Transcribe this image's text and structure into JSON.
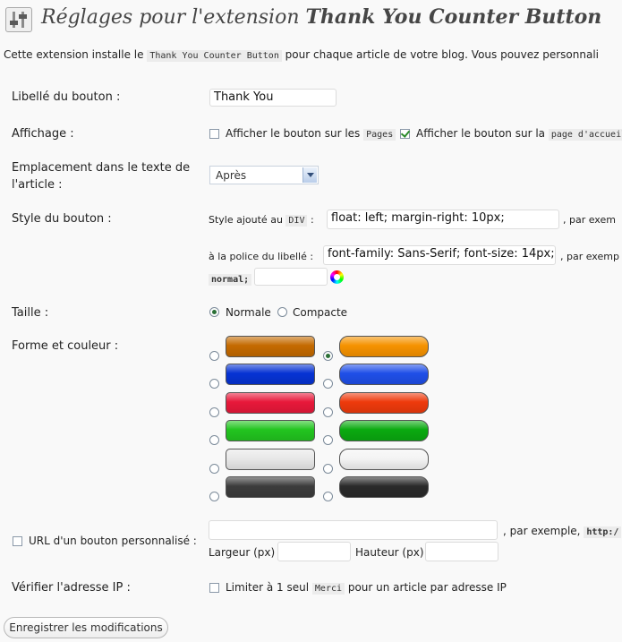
{
  "header": {
    "title_prefix": "Réglages pour l'extension",
    "title_name": "Thank You Counter Button"
  },
  "intro": {
    "text_before": "Cette extension installe le",
    "code": "Thank You Counter Button",
    "text_after": "pour chaque article de votre blog. Vous pouvez personnali"
  },
  "fields": {
    "button_label": {
      "label": "Libellé du bouton :",
      "value": "Thank You"
    },
    "display": {
      "label": "Affichage :",
      "pages_text": "Afficher le bouton sur les",
      "pages_code": "Pages",
      "pages_checked": false,
      "home_text": "Afficher le bouton sur la",
      "home_code": "page d'accueil",
      "home_checked": true
    },
    "placement": {
      "label_line1": "Emplacement dans le texte de",
      "label_line2": "l'article :",
      "value": "Après"
    },
    "style": {
      "label": "Style du bouton :",
      "div_text": "Style ajouté au",
      "div_code": "DIV",
      "colon": ":",
      "div_value": "float: left; margin-right: 10px;",
      "div_after": ", par exem",
      "font_text": "à la police du libellé :",
      "font_value": "font-family: Sans-Serif; font-size: 14px; '",
      "font_after": ", par exemp",
      "normal_code": "normal;",
      "color_value": ""
    },
    "size": {
      "label": "Taille :",
      "option_normal": "Normale",
      "option_compact": "Compacte",
      "selected": "Normale"
    },
    "shape": {
      "label": "Forme et couleur :",
      "selected_index": 1,
      "left_colors": [
        "#c46a00",
        "#0633d4",
        "#e8183a",
        "#22c51f",
        "#e8e8e8",
        "#3c3c3c"
      ],
      "right_colors": [
        "#f59200",
        "#1f4fe8",
        "#ee3a0c",
        "#0aaa10",
        "#f4f4f4",
        "#2a2a2a"
      ]
    },
    "custom_url": {
      "label": "URL d'un bouton personnalisé :",
      "checked": false,
      "value": "",
      "example_text": ", par exemple,",
      "example_code": "http:/",
      "width_label": "Largeur (px)",
      "height_label": "Hauteur (px)",
      "width_value": "",
      "height_value": ""
    },
    "ip_check": {
      "label": "Vérifier l'adresse IP :",
      "checked": false,
      "text_before": "Limiter à 1 seul",
      "code": "Merci",
      "text_after": "pour un article par adresse IP"
    }
  },
  "submit_label": "Enregistrer les modifications"
}
